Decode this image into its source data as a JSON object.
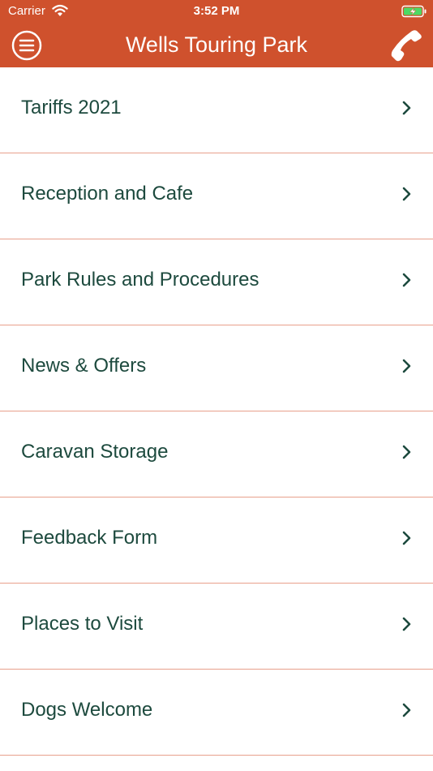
{
  "status_bar": {
    "carrier": "Carrier",
    "time": "3:52 PM",
    "wifi_icon": "wifi-icon",
    "battery_icon": "battery-charging-icon"
  },
  "header": {
    "title": "Wells Touring Park",
    "menu_icon": "hamburger-menu-icon",
    "phone_icon": "phone-icon"
  },
  "menu": {
    "items": [
      {
        "label": "Tariffs 2021"
      },
      {
        "label": "Reception and Cafe"
      },
      {
        "label": "Park Rules and Procedures"
      },
      {
        "label": "News & Offers"
      },
      {
        "label": "Caravan Storage"
      },
      {
        "label": "Feedback Form"
      },
      {
        "label": "Places to Visit"
      },
      {
        "label": "Dogs Welcome"
      }
    ],
    "chevron_icon": "chevron-right-icon"
  },
  "colors": {
    "header_bg": "#cf512d",
    "text": "#1d4a3e",
    "divider": "#e8a08c",
    "battery_fill": "#4cd964"
  }
}
